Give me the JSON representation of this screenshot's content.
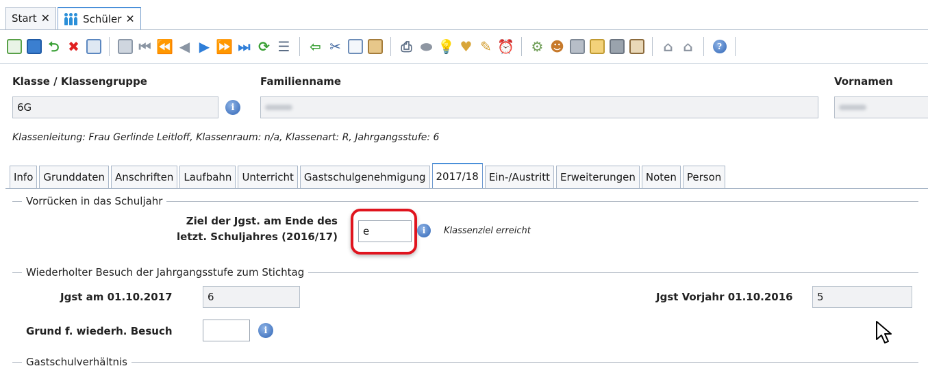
{
  "doc_tabs": [
    {
      "label": "Start",
      "close": "✕"
    },
    {
      "label": "Schüler",
      "close": "✕"
    }
  ],
  "header": {
    "klasse_label": "Klasse / Klassengruppe",
    "klasse_value": "6G",
    "familienname_label": "Familienname",
    "vornamen_label": "Vornamen",
    "info_glyph": "i",
    "klassen_info": "Klassenleitung: Frau Gerlinde Leitloff, Klassenraum: n/a, Klassenart: R, Jahrgangsstufe: 6"
  },
  "form_tabs": [
    "Info",
    "Grunddaten",
    "Anschriften",
    "Laufbahn",
    "Unterricht",
    "Gastschulgenehmigung",
    "2017/18",
    "Ein-/Austritt",
    "Erweiterungen",
    "Noten",
    "Person"
  ],
  "active_tab": "2017/18",
  "sections": {
    "vorruecken": {
      "title": "Vorrücken in das Schuljahr",
      "ziel_label_line1": "Ziel der Jgst. am Ende des",
      "ziel_label_line2": "letzt. Schuljahres (2016/17)",
      "ziel_value": "e",
      "ziel_note": "Klassenziel erreicht"
    },
    "wiederholter": {
      "title": "Wiederholter Besuch der Jahrgangsstufe zum Stichtag",
      "jgst_label": "Jgst am 01.10.2017",
      "jgst_value": "6",
      "vorjahr_label": "Jgst Vorjahr 01.10.2016",
      "vorjahr_value": "5",
      "grund_label": "Grund f. wiederh. Besuch",
      "grund_value": ""
    },
    "gastschul": {
      "title": "Gastschulverhältnis"
    }
  },
  "toolbar_icons": [
    "new-icon",
    "save-icon",
    "undo-icon",
    "delete-icon",
    "list-edit-icon",
    "calculator-icon",
    "first-icon",
    "rewind-icon",
    "previous-icon",
    "next-icon",
    "fast-forward-icon",
    "last-icon",
    "refresh-icon",
    "list-icon",
    "back-arrow-icon",
    "cut-icon",
    "copy-icon",
    "paste-icon",
    "print-icon",
    "disk-icon",
    "lightbulb-icon",
    "heart-icon",
    "broom-icon",
    "alarm-clock-icon",
    "settings-icon",
    "user-icon",
    "grid-icon",
    "export-icon",
    "book-icon",
    "id-card-icon",
    "home-icon",
    "home2-icon",
    "help-icon"
  ],
  "colors": {
    "accent": "#4a90d9",
    "highlight_ring": "#e0141e",
    "info_blue": "#2f64b5"
  }
}
